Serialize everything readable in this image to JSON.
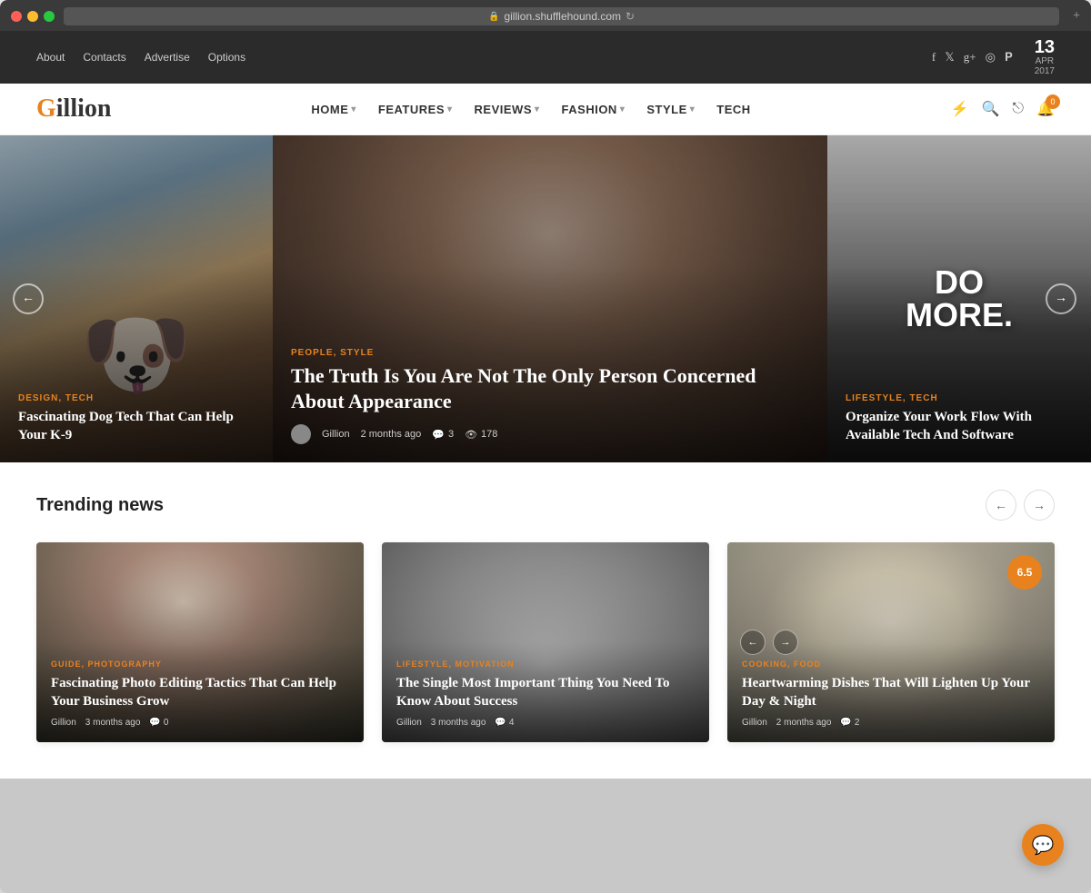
{
  "browser": {
    "url": "gillion.shufflehound.com",
    "expand_icon": "+"
  },
  "topbar": {
    "nav_items": [
      "About",
      "Contacts",
      "Advertise",
      "Options"
    ],
    "social": [
      "f",
      "t",
      "g+",
      "📷",
      "p"
    ],
    "date": {
      "day": "13",
      "month": "APR",
      "year": "2017"
    }
  },
  "header": {
    "logo_prefix": "G",
    "logo_suffix": "illion",
    "nav": [
      {
        "label": "HOME",
        "has_dropdown": true
      },
      {
        "label": "FEATURES",
        "has_dropdown": true
      },
      {
        "label": "REVIEWS",
        "has_dropdown": true
      },
      {
        "label": "FASHION",
        "has_dropdown": true
      },
      {
        "label": "STYLE",
        "has_dropdown": true
      },
      {
        "label": "TECH",
        "has_dropdown": false
      }
    ],
    "notification_count": "0"
  },
  "hero": {
    "slides": [
      {
        "id": "left",
        "tags": "DESIGN, TECH",
        "title": "Fascinating Dog Tech That Can Help Your K-9",
        "has_left_arrow": true
      },
      {
        "id": "center",
        "tags": "PEOPLE, STYLE",
        "title": "The Truth Is You Are Not The Only Person Concerned About Appearance",
        "author": "Gillion",
        "time": "2 months ago",
        "comments": "3",
        "views": "178"
      },
      {
        "id": "right",
        "tags": "LIFESTYLE, TECH",
        "title": "Organize Your Work Flow With Available Tech And Software",
        "do_more_text": "DO\nMORE.",
        "has_right_arrow": true
      }
    ]
  },
  "trending": {
    "section_title": "Trending news",
    "cards": [
      {
        "id": "photo",
        "tags": "GUIDE, PHOTOGRAPHY",
        "title": "Fascinating Photo Editing Tactics That Can Help Your Business Grow",
        "author": "Gillion",
        "time": "3 months ago",
        "comments": "0",
        "has_rating": false
      },
      {
        "id": "motivation",
        "tags": "LIFESTYLE, MOTIVATION",
        "title": "The Single Most Important Thing You Need To Know About Success",
        "author": "Gillion",
        "time": "3 months ago",
        "comments": "4",
        "has_rating": false
      },
      {
        "id": "food",
        "tags": "COOKING, FOOD",
        "title": "Heartwarming Dishes That Will Lighten Up Your Day & Night",
        "author": "Gillion",
        "time": "2 months ago",
        "comments": "2",
        "has_rating": true,
        "rating": "6.5"
      }
    ],
    "prev_label": "←",
    "next_label": "→"
  },
  "chat_icon": "💬"
}
